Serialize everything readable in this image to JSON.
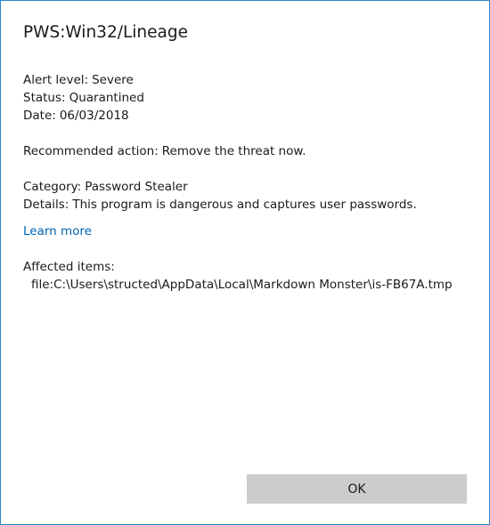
{
  "title": "PWS:Win32/Lineage",
  "alert": {
    "label": "Alert level:",
    "value": "Severe"
  },
  "status": {
    "label": "Status:",
    "value": "Quarantined"
  },
  "date": {
    "label": "Date:",
    "value": "06/03/2018"
  },
  "recommended": {
    "label": "Recommended action:",
    "value": "Remove the threat now."
  },
  "category": {
    "label": "Category:",
    "value": "Password Stealer"
  },
  "details": {
    "label": "Details:",
    "value": "This program is dangerous and captures user passwords."
  },
  "learn_more": "Learn more",
  "affected": {
    "label": "Affected items:",
    "items": [
      {
        "type": "file:",
        "path": "C:\\Users\\structed\\AppData\\Local\\Markdown Monster\\is-FB67A.tmp"
      }
    ]
  },
  "ok_label": "OK",
  "colors": {
    "border": "#2b84c8",
    "link": "#0063b1",
    "button_bg": "#cccccc"
  }
}
